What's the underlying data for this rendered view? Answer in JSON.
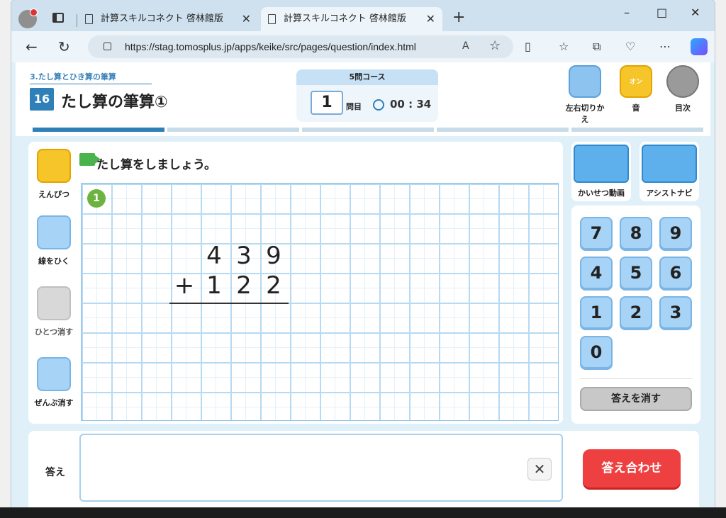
{
  "browser": {
    "tabs": [
      {
        "title": "計算スキルコネクト 啓林館版"
      },
      {
        "title": "計算スキルコネクト 啓林館版"
      }
    ],
    "url": "https://stag.tomosplus.jp/apps/keike/src/pages/question/index.html",
    "window_controls": {
      "minimize": "–",
      "maximize": "□",
      "close": "✕"
    }
  },
  "header": {
    "unit": "3.たし算とひき算の筆算",
    "lesson_no": "16",
    "lesson_title": "たし算の筆算①",
    "course": "5問コース",
    "question_no": "1",
    "question_label": "問目",
    "timer": "00 : 34",
    "buttons": {
      "switch": "左右切りかえ",
      "sound": "音",
      "sound_state": "オン",
      "index": "目次"
    }
  },
  "tools": {
    "pencil": "えんぴつ",
    "line": "線をひく",
    "undo": "ひとつ消す",
    "clear_all": "ぜんぶ消す"
  },
  "board": {
    "instruction": "たし算をしましょう。",
    "problem_no": "1",
    "operator": "+",
    "row1": [
      "4",
      "3",
      "9"
    ],
    "row2": [
      "1",
      "2",
      "2"
    ]
  },
  "side": {
    "video": "かいせつ動画",
    "navi": "アシストナビ",
    "keys": [
      "7",
      "8",
      "9",
      "4",
      "5",
      "6",
      "1",
      "2",
      "3",
      "0"
    ],
    "clear": "答えを消す"
  },
  "answer": {
    "label": "答え",
    "value": "",
    "clear_icon": "✕",
    "check": "答え合わせ"
  },
  "colors": {
    "accent": "#2f7fb8",
    "check_button": "#ee4040",
    "key": "#a6d3f6",
    "badge": "#6db33f"
  },
  "progress": {
    "total_questions": 5,
    "current": 1
  }
}
